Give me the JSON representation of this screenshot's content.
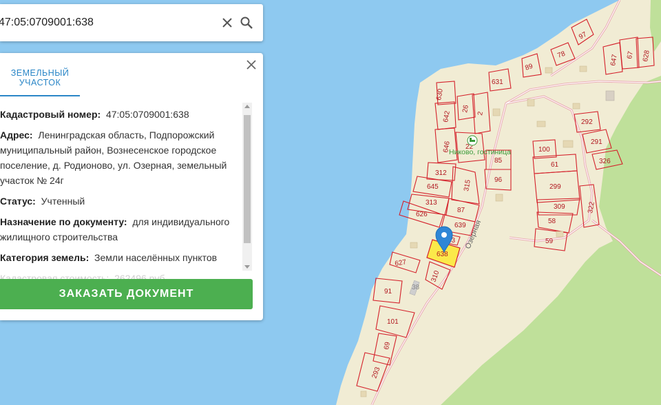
{
  "search": {
    "query": "47:05:0709001:638"
  },
  "card": {
    "tab_label": "ЗЕМЕЛЬНЫЙ УЧАСТОК",
    "properties": [
      {
        "label": "Кадастровый номер:",
        "value": "47:05:0709001:638"
      },
      {
        "label": "Адрес:",
        "value": "Ленинградская область, Подпорожский муниципальный район, Вознесенское городское поселение, д. Родионово, ул. Озерная, земельный участок № 24г"
      },
      {
        "label": "Статус:",
        "value": "Учтенный"
      },
      {
        "label": "Назначение по документу:",
        "value": "для индивидуального жилищного строительства"
      },
      {
        "label": "Категория земель:",
        "value": "Земли населённых пунктов"
      },
      {
        "label": "Кадастровая стоимость:",
        "value": "262496 руб."
      }
    ],
    "order_button": "ЗАКАЗАТЬ ДОКУМЕНТ"
  },
  "map": {
    "colors": {
      "water": "#8ec9f0",
      "land": "#f1ecd4",
      "forest": "#bfe09a",
      "parcel": "#d4202a",
      "selected": "#fbe94a",
      "marker": "#2f86d6",
      "road": "#e8a4ad"
    },
    "street_label": "Озерная",
    "poi_label": "Никово, гостиница",
    "poi_icon": "hotel-bed-icon",
    "marker_icon": "map-pin-icon",
    "selected_parcel": "638",
    "parcels": [
      "97",
      "78",
      "89",
      "631",
      "630",
      "642",
      "26",
      "2",
      "647",
      "67",
      "628",
      "646",
      "22",
      "292",
      "291",
      "326",
      "85",
      "96",
      "100",
      "61",
      "299",
      "312",
      "315",
      "645",
      "313",
      "87",
      "626",
      "639",
      "309",
      "58",
      "322",
      "59",
      "627",
      "310",
      "91",
      "101",
      "69",
      "293",
      "38",
      "33"
    ]
  }
}
